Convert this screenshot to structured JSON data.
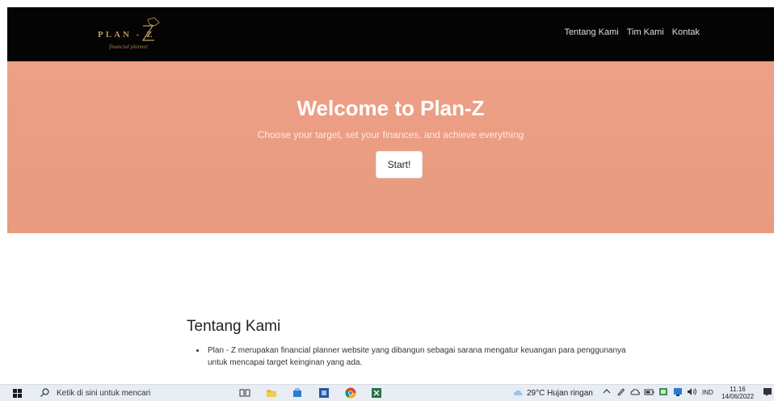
{
  "navbar": {
    "logo_text": "PLAN - Z",
    "logo_tagline": "financial planner",
    "links": [
      {
        "label": "Tentang Kami"
      },
      {
        "label": "Tim Kami"
      },
      {
        "label": "Kontak"
      }
    ]
  },
  "hero": {
    "title": "Welcome to Plan-Z",
    "subtitle": "Choose your target, set your finances, and achieve everything",
    "button_label": "Start!"
  },
  "about": {
    "title": "Tentang Kami",
    "items": [
      "Plan - Z merupakan financial planner website yang dibangun sebagai sarana mengatur keuangan para penggunanya untuk mencapai target keinginan yang ada."
    ]
  },
  "taskbar": {
    "search_placeholder": "Ketik di sini untuk mencari",
    "weather": "29°C  Hujan ringan",
    "language": "IND",
    "time": "11.16",
    "date": "14/06/2022"
  },
  "colors": {
    "navbar_bg": "#050404",
    "hero_bg": "#eb9d82",
    "logo_gold": "#b89a5a"
  }
}
